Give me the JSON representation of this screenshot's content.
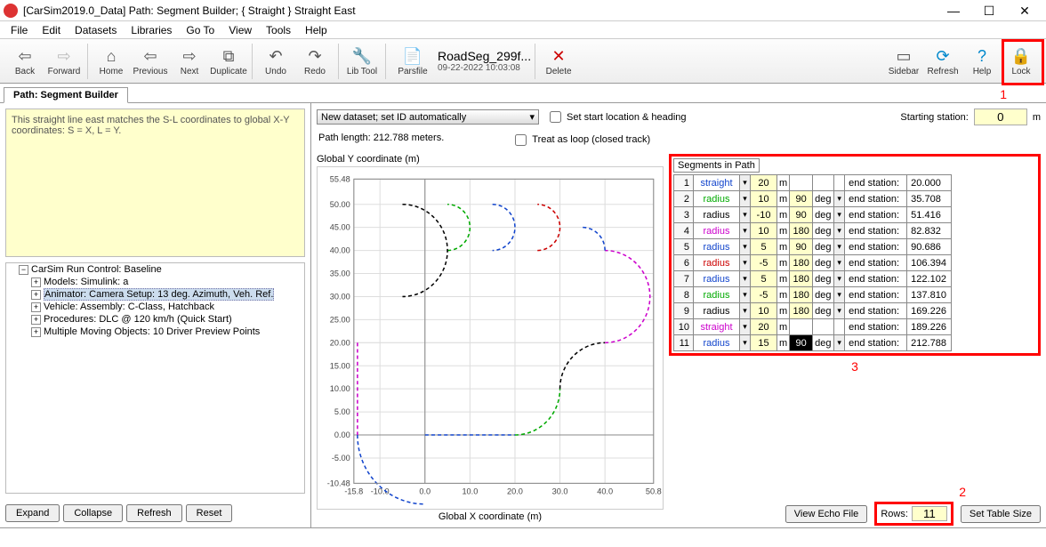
{
  "title": "[CarSim2019.0_Data] Path: Segment Builder; { Straight } Straight East",
  "menubar": [
    "File",
    "Edit",
    "Datasets",
    "Libraries",
    "Go To",
    "View",
    "Tools",
    "Help"
  ],
  "toolbar": {
    "back": "Back",
    "forward": "Forward",
    "home": "Home",
    "previous": "Previous",
    "next": "Next",
    "duplicate": "Duplicate",
    "undo": "Undo",
    "redo": "Redo",
    "libtool": "Lib Tool",
    "parsfile": "Parsfile",
    "parsfile_name": "RoadSeg_299f...",
    "parsfile_date": "09-22-2022 10:03:08",
    "delete": "Delete",
    "sidebar": "Sidebar",
    "refresh": "Refresh",
    "help": "Help",
    "lock": "Lock"
  },
  "subtab": "Path: Segment Builder",
  "note": "This straight line east matches the S-L coordinates to global X-Y coordinates: S = X, L = Y.",
  "tree": {
    "root": "CarSim Run Control: Baseline",
    "items": [
      "Models: Simulink: a",
      "Animator: Camera Setup: 13 deg. Azimuth, Veh. Ref.",
      "Vehicle: Assembly: C-Class, Hatchback",
      "Procedures: DLC @ 120 km/h (Quick Start)",
      "Multiple Moving Objects: 10 Driver Preview Points"
    ],
    "selected_index": 1
  },
  "bottom_buttons": [
    "Expand",
    "Collapse",
    "Refresh",
    "Reset"
  ],
  "dataset_label": "New dataset; set ID automatically",
  "checkbox1": "Set start location & heading",
  "checkbox2": "Treat as loop (closed track)",
  "starting_station_label": "Starting station:",
  "starting_station_value": "0",
  "starting_station_unit": "m",
  "path_length": "Path length: 212.788 meters.",
  "plot_ylabel": "Global Y coordinate (m)",
  "plot_xlabel": "Global X coordinate (m)",
  "segments_title": "Segments in Path",
  "end_station_label": "end station:",
  "unit_m": "m",
  "unit_deg": "deg",
  "segments": [
    {
      "n": "1",
      "type": "straight",
      "type_color": "type-blue",
      "val": "20",
      "deg": "",
      "end": "20.000"
    },
    {
      "n": "2",
      "type": "radius",
      "type_color": "type-green",
      "val": "10",
      "deg": "90",
      "end": "35.708"
    },
    {
      "n": "3",
      "type": "radius",
      "type_color": "type-black",
      "val": "-10",
      "deg": "90",
      "end": "51.416"
    },
    {
      "n": "4",
      "type": "radius",
      "type_color": "type-magenta",
      "val": "10",
      "deg": "180",
      "end": "82.832"
    },
    {
      "n": "5",
      "type": "radius",
      "type_color": "type-blue",
      "val": "5",
      "deg": "90",
      "end": "90.686"
    },
    {
      "n": "6",
      "type": "radius",
      "type_color": "type-red",
      "val": "-5",
      "deg": "180",
      "end": "106.394"
    },
    {
      "n": "7",
      "type": "radius",
      "type_color": "type-blue",
      "val": "5",
      "deg": "180",
      "end": "122.102"
    },
    {
      "n": "8",
      "type": "radius",
      "type_color": "type-green",
      "val": "-5",
      "deg": "180",
      "end": "137.810"
    },
    {
      "n": "9",
      "type": "radius",
      "type_color": "type-black",
      "val": "10",
      "deg": "180",
      "end": "169.226"
    },
    {
      "n": "10",
      "type": "straight",
      "type_color": "type-magenta",
      "val": "20",
      "deg": "",
      "end": "189.226"
    },
    {
      "n": "11",
      "type": "radius",
      "type_color": "type-blue",
      "val": "15",
      "deg": "90",
      "end": "212.788",
      "deg_selected": true
    }
  ],
  "annotations": {
    "a1": "1",
    "a2": "2",
    "a3": "3"
  },
  "right_bottom": {
    "view_echo": "View Echo File",
    "rows_label": "Rows:",
    "rows_value": "11",
    "set_table": "Set Table Size"
  },
  "chart_data": {
    "type": "line",
    "xlabel": "Global X coordinate (m)",
    "ylabel": "Global Y coordinate (m)",
    "xlim": [
      -15.8,
      50.8
    ],
    "ylim": [
      -10.48,
      55.48
    ],
    "xticks": [
      -15.8,
      -10.0,
      0.0,
      10.0,
      20.0,
      30.0,
      40.0,
      50.8
    ],
    "yticks": [
      -10.48,
      -5.0,
      0.0,
      5.0,
      10.0,
      15.0,
      20.0,
      25.0,
      30.0,
      35.0,
      40.0,
      45.0,
      50.0,
      55.48
    ],
    "series": [
      {
        "name": "seg1-straight",
        "color": "#14c",
        "points": [
          [
            0,
            0
          ],
          [
            20,
            0
          ]
        ]
      },
      {
        "name": "seg2-radius",
        "color": "#0a0",
        "arc": {
          "cx": 20,
          "cy": 10,
          "r": 10,
          "start": -90,
          "end": 0
        }
      },
      {
        "name": "seg3-radius",
        "color": "#000",
        "arc": {
          "cx": 40,
          "cy": 10,
          "r": 10,
          "start": 180,
          "end": 90
        }
      },
      {
        "name": "seg4-radius",
        "color": "#c0c",
        "arc": {
          "cx": 40,
          "cy": 30,
          "r": 10,
          "start": -90,
          "end": 90
        }
      },
      {
        "name": "seg5-radius",
        "color": "#14c",
        "arc": {
          "cx": 35,
          "cy": 40,
          "r": 5,
          "start": 0,
          "end": 90
        }
      },
      {
        "name": "seg6-radius",
        "color": "#c00",
        "arc": {
          "cx": 25,
          "cy": 45,
          "r": 5,
          "start": -90,
          "end": 90,
          "sweep": 0
        }
      },
      {
        "name": "seg7-radius",
        "color": "#14c",
        "arc": {
          "cx": 15,
          "cy": 45,
          "r": 5,
          "start": 90,
          "end": -90
        }
      },
      {
        "name": "seg8-radius",
        "color": "#0a0",
        "arc": {
          "cx": 5,
          "cy": 45,
          "r": 5,
          "start": -90,
          "end": 90,
          "sweep": 0
        }
      },
      {
        "name": "seg9-radius",
        "color": "#000",
        "arc": {
          "cx": -5,
          "cy": 40,
          "r": 10,
          "start": 90,
          "end": -90
        }
      },
      {
        "name": "seg10-straight",
        "color": "#c0c",
        "points": [
          [
            -15,
            20
          ],
          [
            -15,
            0
          ]
        ]
      },
      {
        "name": "seg11-radius",
        "color": "#14c",
        "arc": {
          "cx": 0,
          "cy": 0,
          "r": 15,
          "start": 180,
          "end": 270
        }
      }
    ]
  }
}
